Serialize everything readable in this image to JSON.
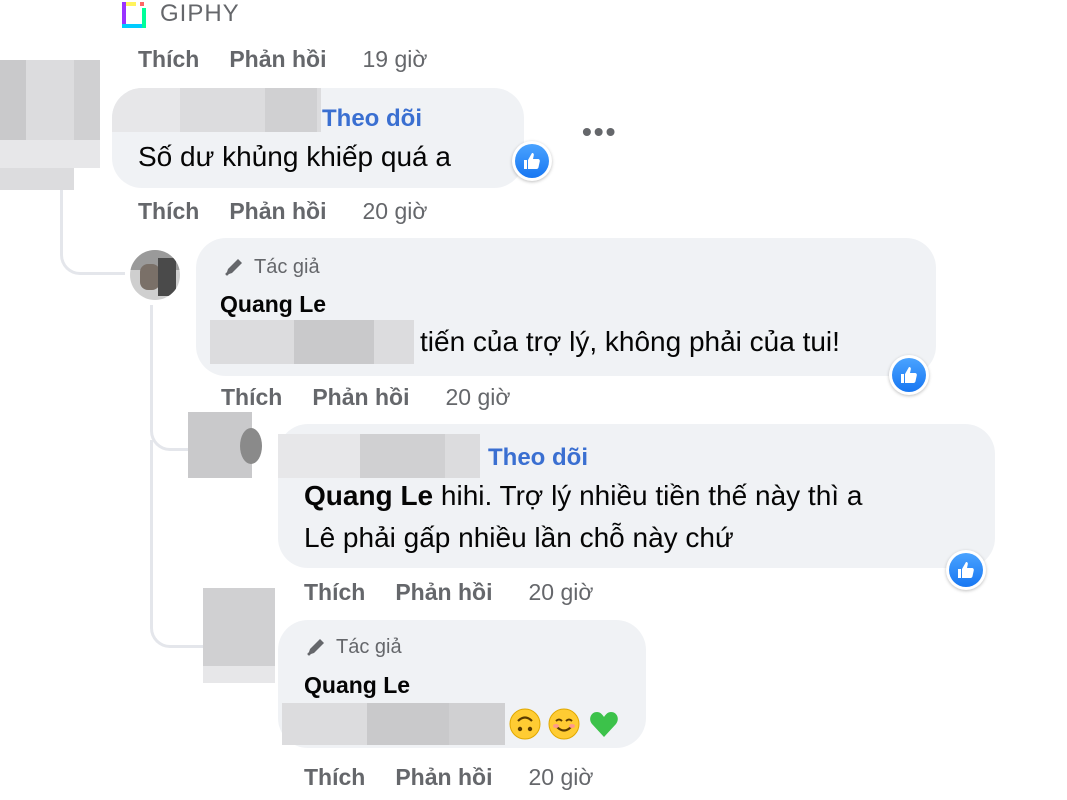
{
  "giphy": {
    "label": "GIPHY"
  },
  "actions": {
    "like": "Thích",
    "reply": "Phản hồi"
  },
  "comments": [
    {
      "id": "top",
      "time": "19 giờ"
    },
    {
      "id": "c1",
      "follow": "Theo dõi",
      "text": "Số dư khủng khiếp quá a",
      "time": "20 giờ",
      "reaction": "like-icon"
    },
    {
      "id": "r1",
      "author_badge": "Tác giả",
      "name": "Quang Le",
      "text": "tiến của trợ lý, không phải của tui!",
      "time": "20 giờ",
      "reaction": "like-icon"
    },
    {
      "id": "r2",
      "follow": "Theo dõi",
      "mention": "Quang Le",
      "text_line1": "hihi. Trợ lý nhiều tiền thế này thì a",
      "text_line2": "Lê phải gấp nhiều lần chỗ này chứ",
      "time": "20 giờ",
      "reaction": "like-icon"
    },
    {
      "id": "r3",
      "author_badge": "Tác giả",
      "name": "Quang Le",
      "emojis": [
        "upside-down-face",
        "smiling-face",
        "green-heart"
      ],
      "time": "20 giờ"
    }
  ],
  "colors": {
    "bubble": "#f0f2f5",
    "follow": "#3a6fd1",
    "muted": "#65676b",
    "like": "#1877f2"
  }
}
